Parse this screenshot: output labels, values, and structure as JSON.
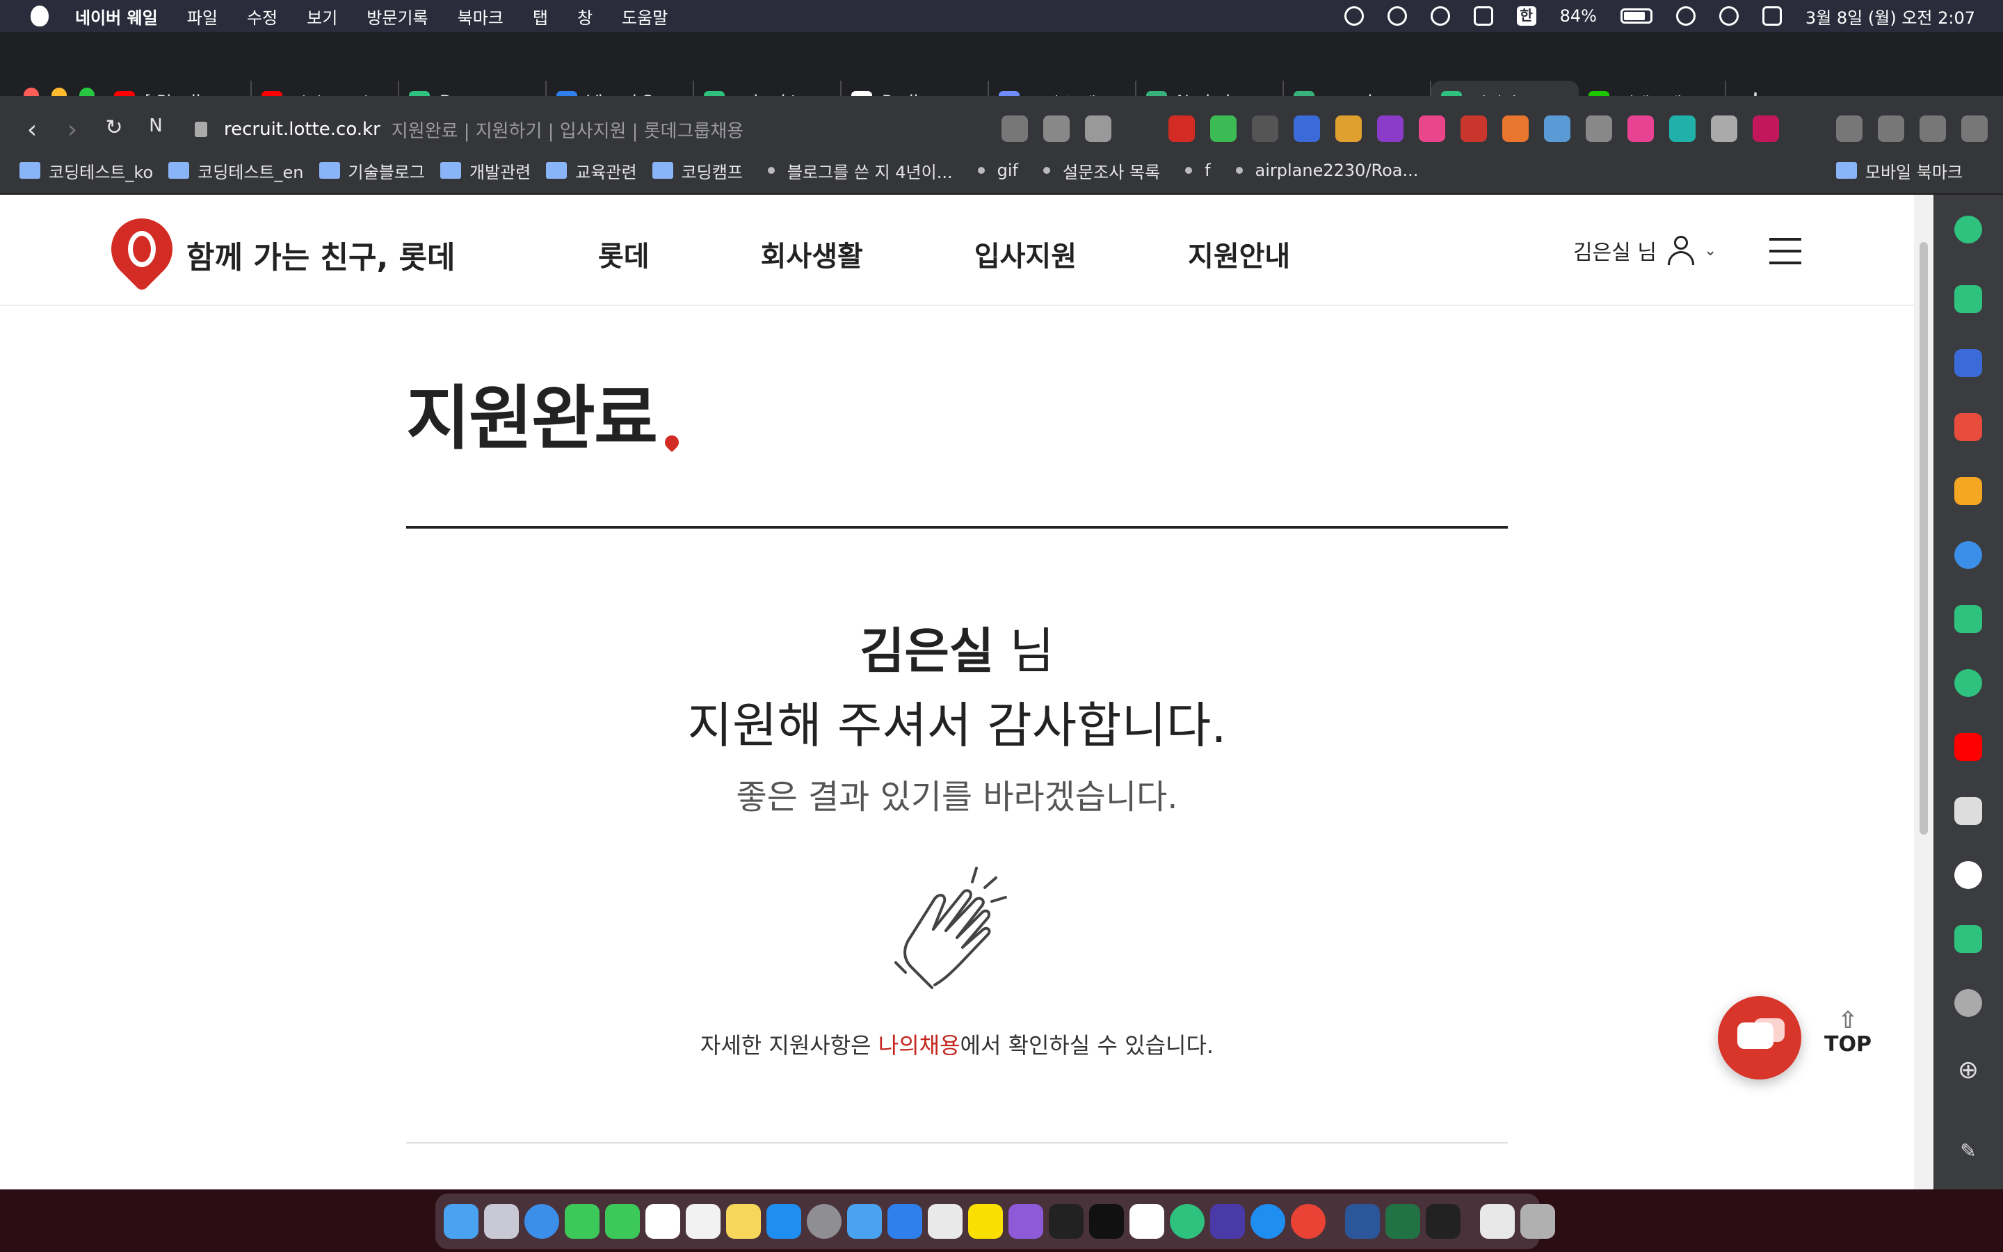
{
  "menubar": {
    "app_name": "네이버 웨일",
    "items": [
      "파일",
      "수정",
      "보기",
      "방문기록",
      "북마크",
      "탭",
      "창",
      "도움말"
    ],
    "battery_percent": "84%",
    "ime_label": "한",
    "clock": "3월 8일 (월) 오전 2:07"
  },
  "tabs": [
    {
      "label": "[ Playlis",
      "color": "#ff0000"
    },
    {
      "label": "자바스크립",
      "color": "#ff0000"
    },
    {
      "label": "Docume",
      "color": "#2ec27e"
    },
    {
      "label": "Visual S",
      "color": "#2f80ed"
    },
    {
      "label": "zelord.t",
      "color": "#2ec27e"
    },
    {
      "label": "Redirec",
      "color": "#ffffff"
    },
    {
      "label": "글자수 세",
      "color": "#6f8cff"
    },
    {
      "label": "Node.js",
      "color": "#38b27a"
    },
    {
      "label": "promise",
      "color": "#38b27a"
    },
    {
      "label": "지원완료",
      "color": "#2ec27e",
      "active": true
    },
    {
      "label": "검색 - 네",
      "color": "#1ec800"
    }
  ],
  "address": {
    "host": "recruit.lotte.co.kr",
    "title": "지원완료 | 지원하기 | 입사지원 | 롯데그룹채용"
  },
  "bookmarks": {
    "items": [
      {
        "label": "코딩테스트_ko",
        "type": "folder"
      },
      {
        "label": "코딩테스트_en",
        "type": "folder"
      },
      {
        "label": "기술블로그",
        "type": "folder"
      },
      {
        "label": "개발관련",
        "type": "folder"
      },
      {
        "label": "교육관련",
        "type": "folder"
      },
      {
        "label": "코딩캠프",
        "type": "folder"
      },
      {
        "label": "블로그를 쓴 지 4년이...",
        "type": "link"
      },
      {
        "label": "gif",
        "type": "link"
      },
      {
        "label": "설문조사 목록",
        "type": "link"
      },
      {
        "label": "f",
        "type": "link"
      },
      {
        "label": "airplane2230/Roa...",
        "type": "link"
      }
    ],
    "mobile_label": "모바일 북마크"
  },
  "site": {
    "logo_text": "함께 가는 친구, 롯데",
    "nav": [
      "롯데",
      "회사생활",
      "입사지원",
      "지원안내"
    ],
    "user_label": "김은실 님",
    "brand_color": "#d22c24"
  },
  "content": {
    "page_title": "지원완료",
    "user_name": "김은실",
    "honorific": "님",
    "thanks": "지원해 주셔서 감사합니다.",
    "wish": "좋은 결과 있기를 바라겠습니다.",
    "detail_before": "자세한 지원사항은 ",
    "detail_link": "나의채용",
    "detail_after": "에서 확인하실 수 있습니다.",
    "top_label": "TOP"
  }
}
